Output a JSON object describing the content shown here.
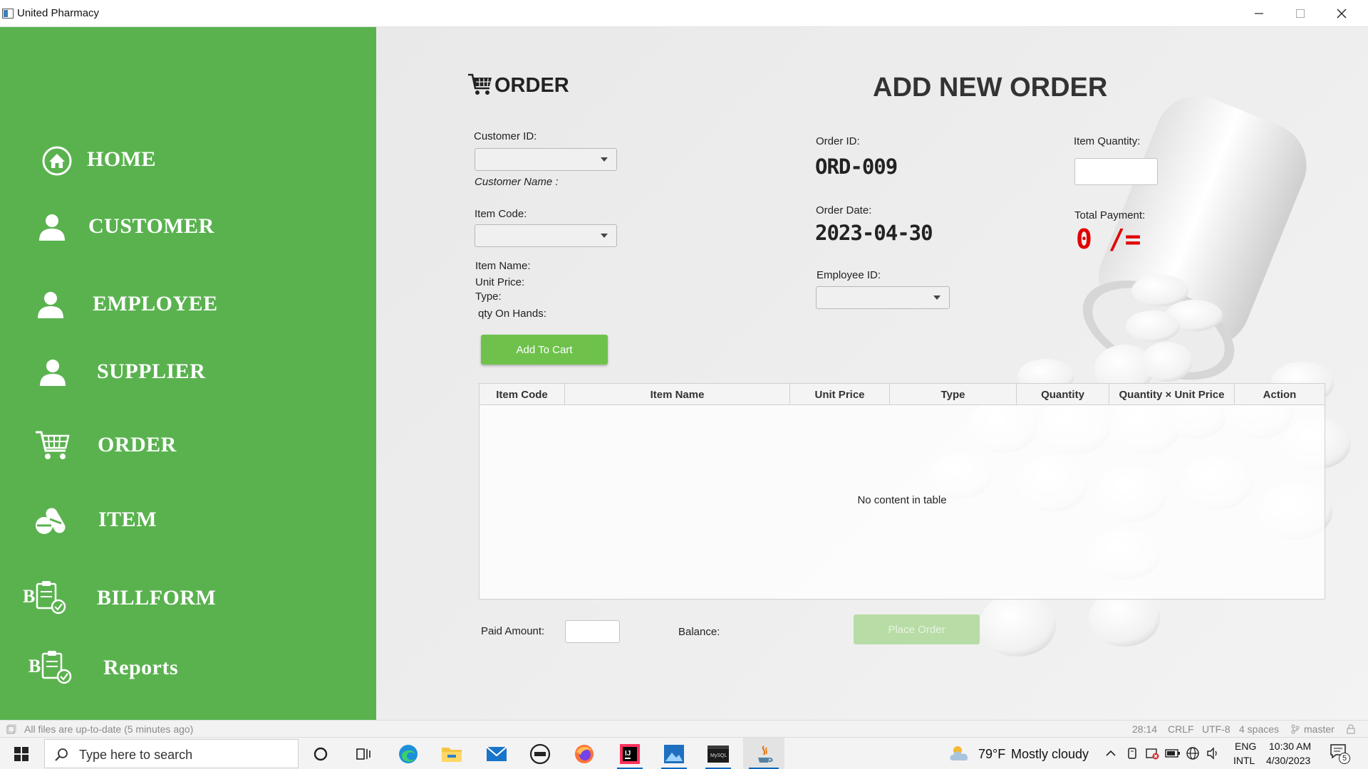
{
  "window": {
    "title": "United Pharmacy",
    "minimize": "—",
    "maximize": "☐",
    "close": "✕"
  },
  "sidebar": {
    "items": [
      {
        "label": "HOME",
        "icon": "home-icon"
      },
      {
        "label": "CUSTOMER",
        "icon": "person-icon"
      },
      {
        "label": "EMPLOYEE",
        "icon": "person-icon"
      },
      {
        "label": "SUPPLIER",
        "icon": "person-icon"
      },
      {
        "label": "ORDER",
        "icon": "cart-icon"
      },
      {
        "label": "ITEM",
        "icon": "pills-icon"
      },
      {
        "label": "BILLFORM",
        "icon": "bill-icon"
      },
      {
        "label": "Reports",
        "icon": "bill-icon"
      }
    ],
    "background": "#5ab24f"
  },
  "header": {
    "section_label": "ORDER",
    "title": "ADD NEW ORDER"
  },
  "form": {
    "customer_id_label": "Customer ID:",
    "customer_name_label": "Customer Name :",
    "item_code_label": "Item Code:",
    "item_name_label": "Item Name:",
    "unit_price_label": "Unit Price:",
    "type_label": "Type:",
    "qty_on_hands_label": "qty On Hands:",
    "add_to_cart_label": "Add To Cart",
    "order_id_label": "Order ID:",
    "order_id_value": "ORD-009",
    "order_date_label": "Order Date:",
    "order_date_value": "2023-04-30",
    "employee_id_label": "Employee ID:",
    "item_quantity_label": "Item Quantity:",
    "item_quantity_value": "",
    "total_payment_label": "Total Payment:",
    "total_payment_value": "0 /=",
    "total_payment_color": "#e00000"
  },
  "table": {
    "columns": [
      "Item Code",
      "Item Name",
      "Unit Price",
      "Type",
      "Quantity",
      "Quantity × Unit Price",
      "Action"
    ],
    "rows": [],
    "empty_text": "No content in table"
  },
  "footer": {
    "paid_amount_label": "Paid Amount:",
    "paid_amount_value": "",
    "balance_label": "Balance:",
    "place_order_label": "Place Order",
    "place_order_enabled": false
  },
  "ide_status": {
    "message": "All files are up-to-date (5 minutes ago)",
    "position": "28:14",
    "line_ending": "CRLF",
    "encoding": "UTF-8",
    "indent": "4 spaces",
    "branch": "master"
  },
  "taskbar": {
    "search_placeholder": "Type here to search",
    "weather_temp": "79°F",
    "weather_text": "Mostly cloudy",
    "language_1": "ENG",
    "language_2": "INTL",
    "time": "10:30 AM",
    "date": "4/30/2023",
    "notification_count": "5"
  }
}
